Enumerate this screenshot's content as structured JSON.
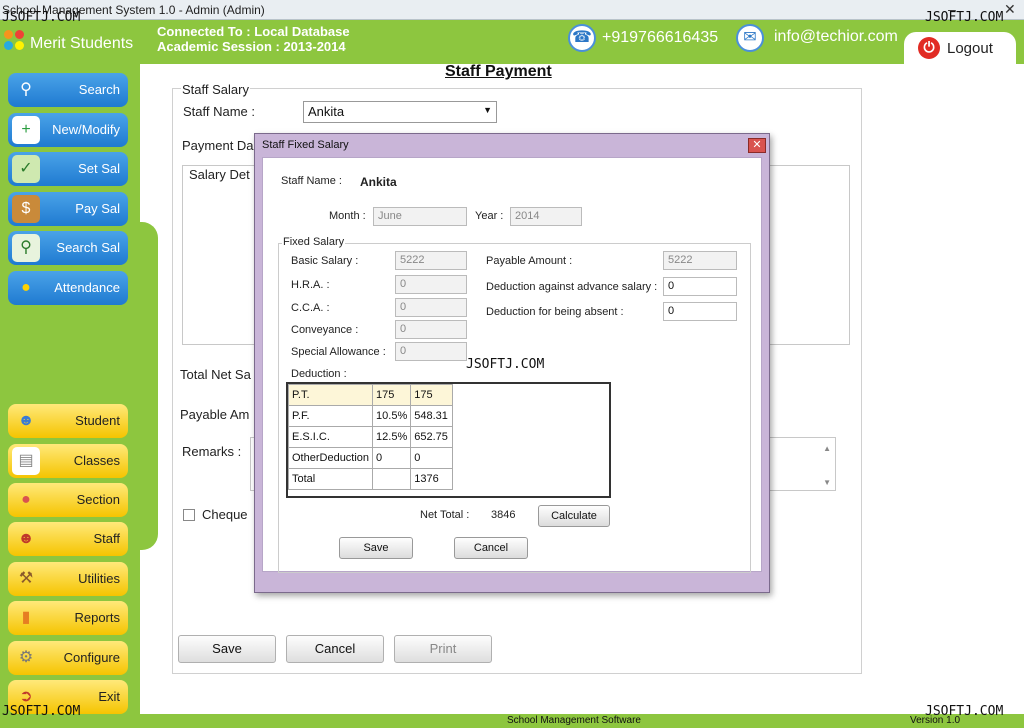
{
  "window": {
    "title": "School Management System 1.0 - Admin (Admin)"
  },
  "header": {
    "app_name": "Merit Students",
    "connected": "Connected To : Local Database",
    "session": "Academic Session : 2013-2014",
    "phone": "+919766616435",
    "email": "info@techior.com",
    "logout": "Logout"
  },
  "sidebar": {
    "top": [
      {
        "label": "Search",
        "icon": "magnifier-icon"
      },
      {
        "label": "New/Modify",
        "icon": "add-document-icon"
      },
      {
        "label": "Set Sal",
        "icon": "money-check-icon"
      },
      {
        "label": "Pay Sal",
        "icon": "wallet-icon"
      },
      {
        "label": "Search Sal",
        "icon": "search-money-icon"
      },
      {
        "label": "Attendance",
        "icon": "people-icon"
      }
    ],
    "bottom": [
      {
        "label": "Student",
        "icon": "students-icon"
      },
      {
        "label": "Classes",
        "icon": "pages-icon"
      },
      {
        "label": "Section",
        "icon": "group-icon"
      },
      {
        "label": "Staff",
        "icon": "staff-icon"
      },
      {
        "label": "Utilities",
        "icon": "tools-icon"
      },
      {
        "label": "Reports",
        "icon": "chart-icon"
      },
      {
        "label": "Configure",
        "icon": "gear-icon"
      },
      {
        "label": "Exit",
        "icon": "exit-door-icon"
      }
    ]
  },
  "main": {
    "title": "Staff Payment",
    "group": "Staff Salary",
    "staff_name_label": "Staff Name :",
    "staff_name": "Ankita",
    "payment_date_label": "Payment Da",
    "salary_details_label": "Salary Det",
    "total_net_label": "Total Net Sa",
    "payable_label": "Payable Am",
    "remarks_label": "Remarks :",
    "cheque_label": "Cheque",
    "save": "Save",
    "cancel": "Cancel",
    "print": "Print"
  },
  "dialog": {
    "title": "Staff Fixed Salary",
    "staff_name_label": "Staff Name :",
    "staff_name": "Ankita",
    "month_label": "Month :",
    "month": "June",
    "year_label": "Year :",
    "year": "2014",
    "fixed_group": "Fixed Salary",
    "basic_label": "Basic Salary :",
    "basic": "5222",
    "hra_label": "H.R.A. :",
    "hra": "0",
    "cca_label": "C.C.A. :",
    "cca": "0",
    "conveyance_label": "Conveyance :",
    "conveyance": "0",
    "special_label": "Special Allowance :",
    "special": "0",
    "payable_label": "Payable Amount :",
    "payable": "5222",
    "adv_label": "Deduction against advance salary :",
    "adv": "0",
    "absent_label": "Deduction for being absent :",
    "absent": "0",
    "deduction_label": "Deduction :",
    "deductions": [
      {
        "name": "P.T.",
        "rate": "175",
        "amount": "175"
      },
      {
        "name": "P.F.",
        "rate": "10.5%",
        "amount": "548.31"
      },
      {
        "name": "E.S.I.C.",
        "rate": "12.5%",
        "amount": "652.75"
      },
      {
        "name": "OtherDeduction",
        "rate": "0",
        "amount": "0"
      },
      {
        "name": "Total",
        "rate": "",
        "amount": "1376"
      }
    ],
    "net_total_label": "Net Total :",
    "net_total": "3846",
    "calculate": "Calculate",
    "save": "Save",
    "cancel": "Cancel"
  },
  "watermark": "JSOFTJ.COM",
  "footer": {
    "center": "School Management Software",
    "version": "Version 1.0"
  }
}
